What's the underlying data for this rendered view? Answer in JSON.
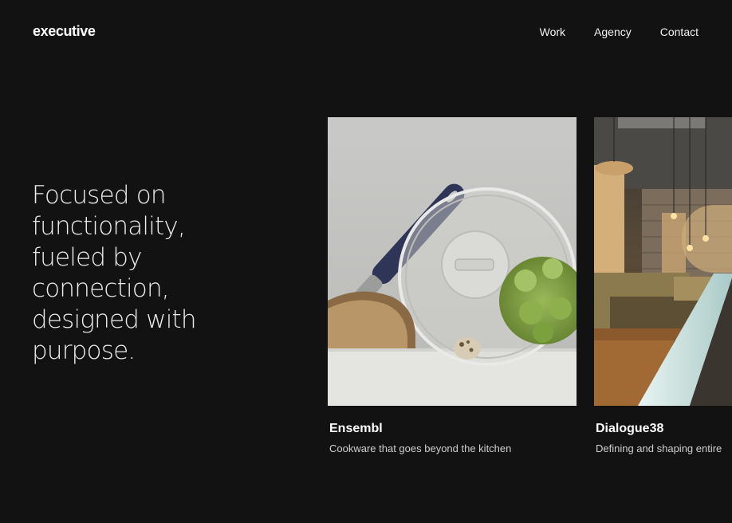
{
  "header": {
    "logo": "executive",
    "nav": [
      "Work",
      "Agency",
      "Contact"
    ]
  },
  "hero": {
    "lines": [
      "Focused on",
      "functionality,",
      "fueled by",
      "connection,",
      "designed with",
      "purpose."
    ]
  },
  "projects": [
    {
      "title": "Ensembl",
      "subtitle": "Cookware that goes beyond the kitchen"
    },
    {
      "title": "Dialogue38",
      "subtitle": "Defining and shaping entire"
    }
  ],
  "colors": {
    "background": "#121212",
    "text": "#ffffff",
    "muted": "#cfcfcf"
  }
}
